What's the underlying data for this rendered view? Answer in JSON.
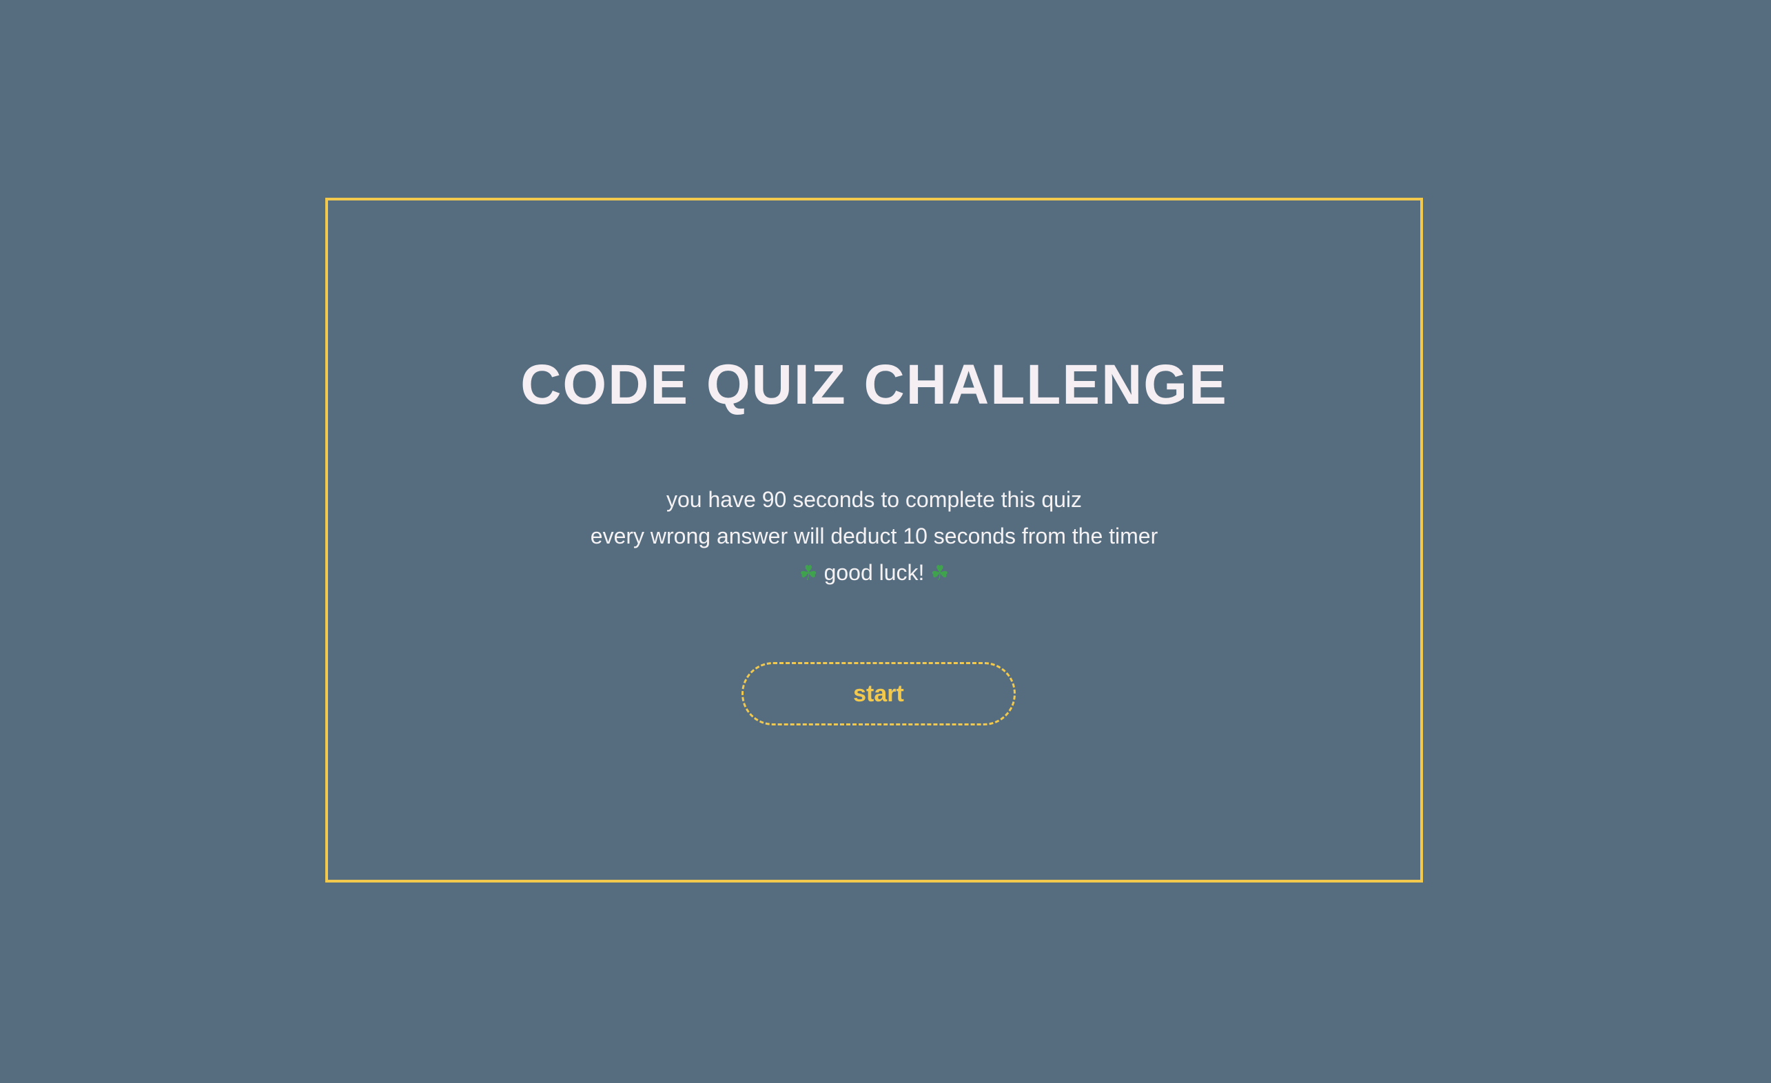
{
  "quiz": {
    "title": "CODE QUIZ CHALLENGE",
    "instructions": {
      "line1": "you have 90 seconds to complete this quiz",
      "line2": "every wrong answer will deduct 10 seconds from the timer",
      "line3_text": " good luck! ",
      "clover": "☘"
    },
    "start_label": "start"
  },
  "colors": {
    "background": "#566d80",
    "accent": "#f2c94c",
    "text": "#f5eef2",
    "clover": "#3fa34d"
  }
}
